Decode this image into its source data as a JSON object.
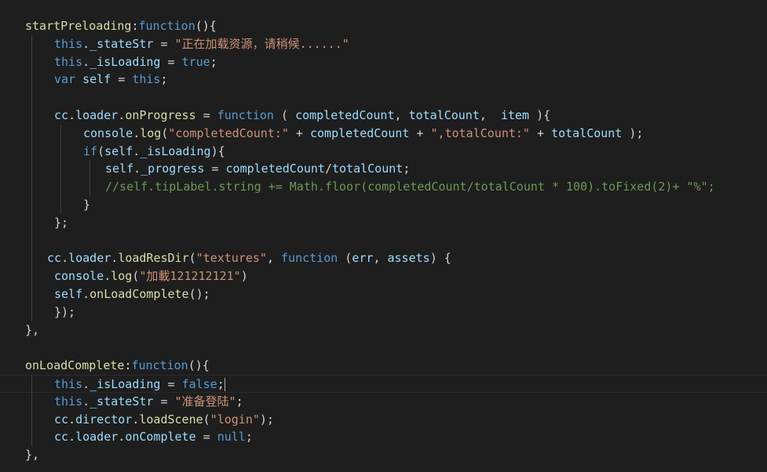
{
  "editor": {
    "language": "javascript",
    "theme": "dark",
    "colors": {
      "background": "#1e1e1e",
      "function": "#dcdcaa",
      "variable": "#9cdcfe",
      "keyword": "#569cd6",
      "string": "#ce9178",
      "comment": "#6a9955",
      "punctuation": "#d4d4d4"
    },
    "lines": [
      [
        {
          "t": "startPreloading",
          "c": "fn"
        },
        {
          "t": ":",
          "c": "punc"
        },
        {
          "t": "function",
          "c": "kw"
        },
        {
          "t": "(){",
          "c": "punc"
        }
      ],
      [
        {
          "t": "this",
          "c": "kw"
        },
        {
          "t": ".",
          "c": "punc"
        },
        {
          "t": "_stateStr",
          "c": "var"
        },
        {
          "t": " = ",
          "c": "op"
        },
        {
          "t": "\"正在加载资源，请稍候......\"",
          "c": "str"
        }
      ],
      [
        {
          "t": "this",
          "c": "kw"
        },
        {
          "t": ".",
          "c": "punc"
        },
        {
          "t": "_isLoading",
          "c": "var"
        },
        {
          "t": " = ",
          "c": "op"
        },
        {
          "t": "true",
          "c": "kw"
        },
        {
          "t": ";",
          "c": "punc"
        }
      ],
      [
        {
          "t": "var",
          "c": "kw"
        },
        {
          "t": " ",
          "c": "punc"
        },
        {
          "t": "self",
          "c": "var"
        },
        {
          "t": " = ",
          "c": "op"
        },
        {
          "t": "this",
          "c": "kw"
        },
        {
          "t": ";",
          "c": "punc"
        }
      ],
      [],
      [
        {
          "t": "cc",
          "c": "var"
        },
        {
          "t": ".",
          "c": "punc"
        },
        {
          "t": "loader",
          "c": "var"
        },
        {
          "t": ".",
          "c": "punc"
        },
        {
          "t": "onProgress",
          "c": "fn"
        },
        {
          "t": " = ",
          "c": "op"
        },
        {
          "t": "function",
          "c": "kw"
        },
        {
          "t": " ( ",
          "c": "punc"
        },
        {
          "t": "completedCount",
          "c": "var"
        },
        {
          "t": ", ",
          "c": "punc"
        },
        {
          "t": "totalCount",
          "c": "var"
        },
        {
          "t": ",  ",
          "c": "punc"
        },
        {
          "t": "item",
          "c": "var"
        },
        {
          "t": " ){",
          "c": "punc"
        }
      ],
      [
        {
          "t": "console",
          "c": "var"
        },
        {
          "t": ".",
          "c": "punc"
        },
        {
          "t": "log",
          "c": "fn"
        },
        {
          "t": "(",
          "c": "punc"
        },
        {
          "t": "\"completedCount:\"",
          "c": "str"
        },
        {
          "t": " + ",
          "c": "op"
        },
        {
          "t": "completedCount",
          "c": "var"
        },
        {
          "t": " + ",
          "c": "op"
        },
        {
          "t": "\",totalCount:\"",
          "c": "str"
        },
        {
          "t": " + ",
          "c": "op"
        },
        {
          "t": "totalCount",
          "c": "var"
        },
        {
          "t": " );",
          "c": "punc"
        }
      ],
      [
        {
          "t": "if",
          "c": "kw"
        },
        {
          "t": "(",
          "c": "punc"
        },
        {
          "t": "self",
          "c": "var"
        },
        {
          "t": ".",
          "c": "punc"
        },
        {
          "t": "_isLoading",
          "c": "var"
        },
        {
          "t": "){",
          "c": "punc"
        }
      ],
      [
        {
          "t": "self",
          "c": "var"
        },
        {
          "t": ".",
          "c": "punc"
        },
        {
          "t": "_progress",
          "c": "var"
        },
        {
          "t": " = ",
          "c": "op"
        },
        {
          "t": "completedCount",
          "c": "var"
        },
        {
          "t": "/",
          "c": "op"
        },
        {
          "t": "totalCount",
          "c": "var"
        },
        {
          "t": ";",
          "c": "punc"
        }
      ],
      [
        {
          "t": "//self.tipLabel.string += Math.floor(completedCount/totalCount * 100).toFixed(2)+ \"%\";",
          "c": "cm"
        }
      ],
      [
        {
          "t": "}",
          "c": "punc"
        }
      ],
      [
        {
          "t": "};",
          "c": "punc"
        }
      ],
      [],
      [
        {
          "t": "cc",
          "c": "var"
        },
        {
          "t": ".",
          "c": "punc"
        },
        {
          "t": "loader",
          "c": "var"
        },
        {
          "t": ".",
          "c": "punc"
        },
        {
          "t": "loadResDir",
          "c": "fn"
        },
        {
          "t": "(",
          "c": "punc"
        },
        {
          "t": "\"textures\"",
          "c": "str"
        },
        {
          "t": ", ",
          "c": "punc"
        },
        {
          "t": "function",
          "c": "kw"
        },
        {
          "t": " (",
          "c": "punc"
        },
        {
          "t": "err",
          "c": "var"
        },
        {
          "t": ", ",
          "c": "punc"
        },
        {
          "t": "assets",
          "c": "var"
        },
        {
          "t": ") {",
          "c": "punc"
        }
      ],
      [
        {
          "t": "console",
          "c": "var"
        },
        {
          "t": ".",
          "c": "punc"
        },
        {
          "t": "log",
          "c": "fn"
        },
        {
          "t": "(",
          "c": "punc"
        },
        {
          "t": "\"加載121212121\"",
          "c": "str"
        },
        {
          "t": ")",
          "c": "punc"
        }
      ],
      [
        {
          "t": "self",
          "c": "var"
        },
        {
          "t": ".",
          "c": "punc"
        },
        {
          "t": "onLoadComplete",
          "c": "fn"
        },
        {
          "t": "();",
          "c": "punc"
        }
      ],
      [
        {
          "t": "});",
          "c": "punc"
        }
      ],
      [
        {
          "t": "},",
          "c": "punc"
        }
      ],
      [],
      [
        {
          "t": "onLoadComplete",
          "c": "fn"
        },
        {
          "t": ":",
          "c": "punc"
        },
        {
          "t": "function",
          "c": "kw"
        },
        {
          "t": "(){",
          "c": "punc"
        }
      ],
      [
        {
          "t": "this",
          "c": "kw"
        },
        {
          "t": ".",
          "c": "punc"
        },
        {
          "t": "_isLoading",
          "c": "var"
        },
        {
          "t": " = ",
          "c": "op"
        },
        {
          "t": "false",
          "c": "kw"
        },
        {
          "t": ";",
          "c": "punc"
        }
      ],
      [
        {
          "t": "this",
          "c": "kw"
        },
        {
          "t": ".",
          "c": "punc"
        },
        {
          "t": "_stateStr",
          "c": "var"
        },
        {
          "t": " = ",
          "c": "op"
        },
        {
          "t": "\"准备登陆\"",
          "c": "str"
        },
        {
          "t": ";",
          "c": "punc"
        }
      ],
      [
        {
          "t": "cc",
          "c": "var"
        },
        {
          "t": ".",
          "c": "punc"
        },
        {
          "t": "director",
          "c": "var"
        },
        {
          "t": ".",
          "c": "punc"
        },
        {
          "t": "loadScene",
          "c": "fn"
        },
        {
          "t": "(",
          "c": "punc"
        },
        {
          "t": "\"login\"",
          "c": "str"
        },
        {
          "t": ");",
          "c": "punc"
        }
      ],
      [
        {
          "t": "cc",
          "c": "var"
        },
        {
          "t": ".",
          "c": "punc"
        },
        {
          "t": "loader",
          "c": "var"
        },
        {
          "t": ".",
          "c": "punc"
        },
        {
          "t": "onComplete",
          "c": "var"
        },
        {
          "t": " = ",
          "c": "op"
        },
        {
          "t": "null",
          "c": "kw"
        },
        {
          "t": ";",
          "c": "punc"
        }
      ],
      [
        {
          "t": "},",
          "c": "punc"
        }
      ]
    ]
  }
}
